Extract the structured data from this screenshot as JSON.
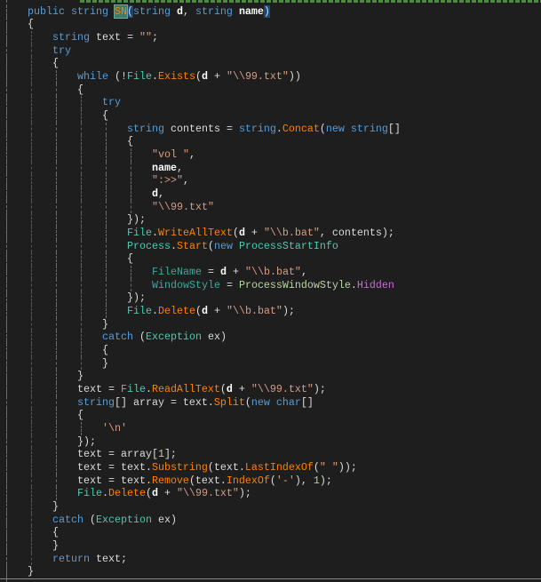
{
  "editor": {
    "guide_colors": [
      "#2f8f5f",
      "#2a5f95",
      "#c84444",
      "#8a3ab8",
      "#c84444",
      "#6a6a6a"
    ],
    "lines": [
      {
        "indent": 1,
        "tokens": [
          {
            "t": "public",
            "c": "kw"
          },
          {
            "t": " "
          },
          {
            "t": "string",
            "c": "kw"
          },
          {
            "t": " "
          },
          {
            "t": "SN",
            "c": "method",
            "hl": "ref"
          },
          {
            "t": "(",
            "c": "punct",
            "hl": "brace"
          },
          {
            "t": "string",
            "c": "kw"
          },
          {
            "t": " "
          },
          {
            "t": "d",
            "c": "param"
          },
          {
            "t": ", "
          },
          {
            "t": "string",
            "c": "kw"
          },
          {
            "t": " "
          },
          {
            "t": "name",
            "c": "param"
          },
          {
            "t": ")",
            "c": "punct",
            "hl": "brace"
          }
        ]
      },
      {
        "indent": 1,
        "tokens": [
          {
            "t": "{"
          }
        ]
      },
      {
        "indent": 2,
        "tokens": [
          {
            "t": "string",
            "c": "kw"
          },
          {
            "t": " text = "
          },
          {
            "t": "\"\"",
            "c": "str"
          },
          {
            "t": ";"
          }
        ]
      },
      {
        "indent": 2,
        "tokens": [
          {
            "t": "try",
            "c": "kw"
          }
        ]
      },
      {
        "indent": 2,
        "tokens": [
          {
            "t": "{"
          }
        ]
      },
      {
        "indent": 3,
        "tokens": [
          {
            "t": "while",
            "c": "kw"
          },
          {
            "t": " (!"
          },
          {
            "t": "File",
            "c": "type"
          },
          {
            "t": "."
          },
          {
            "t": "Exists",
            "c": "method"
          },
          {
            "t": "("
          },
          {
            "t": "d",
            "c": "param"
          },
          {
            "t": " + "
          },
          {
            "t": "\"\\\\99.txt\"",
            "c": "str"
          },
          {
            "t": "))"
          }
        ]
      },
      {
        "indent": 3,
        "tokens": [
          {
            "t": "{"
          }
        ]
      },
      {
        "indent": 4,
        "tokens": [
          {
            "t": "try",
            "c": "kw"
          }
        ]
      },
      {
        "indent": 4,
        "tokens": [
          {
            "t": "{"
          }
        ]
      },
      {
        "indent": 5,
        "tokens": [
          {
            "t": "string",
            "c": "kw"
          },
          {
            "t": " contents = "
          },
          {
            "t": "string",
            "c": "kw"
          },
          {
            "t": "."
          },
          {
            "t": "Concat",
            "c": "method"
          },
          {
            "t": "("
          },
          {
            "t": "new",
            "c": "kw"
          },
          {
            "t": " "
          },
          {
            "t": "string",
            "c": "kw"
          },
          {
            "t": "[]"
          }
        ]
      },
      {
        "indent": 5,
        "tokens": [
          {
            "t": "{"
          }
        ]
      },
      {
        "indent": 6,
        "init": true,
        "tokens": [
          {
            "t": "\"vol \"",
            "c": "str"
          },
          {
            "t": ","
          }
        ]
      },
      {
        "indent": 6,
        "init": true,
        "tokens": [
          {
            "t": "name",
            "c": "param"
          },
          {
            "t": ","
          }
        ]
      },
      {
        "indent": 6,
        "init": true,
        "tokens": [
          {
            "t": "\":>>\"",
            "c": "str"
          },
          {
            "t": ","
          }
        ]
      },
      {
        "indent": 6,
        "init": true,
        "tokens": [
          {
            "t": "d",
            "c": "param"
          },
          {
            "t": ","
          }
        ]
      },
      {
        "indent": 6,
        "init": true,
        "tokens": [
          {
            "t": "\"\\\\99.txt\"",
            "c": "str"
          }
        ]
      },
      {
        "indent": 5,
        "tokens": [
          {
            "t": "});"
          }
        ]
      },
      {
        "indent": 5,
        "tokens": [
          {
            "t": "File",
            "c": "type"
          },
          {
            "t": "."
          },
          {
            "t": "WriteAllText",
            "c": "method"
          },
          {
            "t": "("
          },
          {
            "t": "d",
            "c": "param"
          },
          {
            "t": " + "
          },
          {
            "t": "\"\\\\b.bat\"",
            "c": "str"
          },
          {
            "t": ", contents);"
          }
        ]
      },
      {
        "indent": 5,
        "tokens": [
          {
            "t": "Process",
            "c": "type"
          },
          {
            "t": "."
          },
          {
            "t": "Start",
            "c": "method"
          },
          {
            "t": "("
          },
          {
            "t": "new",
            "c": "kw"
          },
          {
            "t": " "
          },
          {
            "t": "ProcessStartInfo",
            "c": "type"
          }
        ]
      },
      {
        "indent": 5,
        "tokens": [
          {
            "t": "{"
          }
        ]
      },
      {
        "indent": 6,
        "init": true,
        "tokens": [
          {
            "t": "FileName",
            "c": "prop"
          },
          {
            "t": " = "
          },
          {
            "t": "d",
            "c": "param"
          },
          {
            "t": " + "
          },
          {
            "t": "\"\\\\b.bat\"",
            "c": "str"
          },
          {
            "t": ","
          }
        ]
      },
      {
        "indent": 6,
        "init": true,
        "tokens": [
          {
            "t": "WindowStyle",
            "c": "prop"
          },
          {
            "t": " = "
          },
          {
            "t": "ProcessWindowStyle",
            "c": "enumtype"
          },
          {
            "t": "."
          },
          {
            "t": "Hidden",
            "c": "enumfield"
          }
        ]
      },
      {
        "indent": 5,
        "tokens": [
          {
            "t": "});"
          }
        ]
      },
      {
        "indent": 5,
        "tokens": [
          {
            "t": "File",
            "c": "type"
          },
          {
            "t": "."
          },
          {
            "t": "Delete",
            "c": "method"
          },
          {
            "t": "("
          },
          {
            "t": "d",
            "c": "param"
          },
          {
            "t": " + "
          },
          {
            "t": "\"\\\\b.bat\"",
            "c": "str"
          },
          {
            "t": ");"
          }
        ]
      },
      {
        "indent": 4,
        "tokens": [
          {
            "t": "}"
          }
        ]
      },
      {
        "indent": 4,
        "tokens": [
          {
            "t": "catch",
            "c": "kw"
          },
          {
            "t": " ("
          },
          {
            "t": "Exception",
            "c": "type"
          },
          {
            "t": " ex)"
          }
        ]
      },
      {
        "indent": 4,
        "tokens": [
          {
            "t": "{"
          }
        ]
      },
      {
        "indent": 4,
        "tokens": [
          {
            "t": "}"
          }
        ]
      },
      {
        "indent": 3,
        "tokens": [
          {
            "t": "}"
          }
        ]
      },
      {
        "indent": 3,
        "tokens": [
          {
            "t": "text = "
          },
          {
            "t": "File",
            "c": "type"
          },
          {
            "t": "."
          },
          {
            "t": "ReadAllText",
            "c": "method"
          },
          {
            "t": "("
          },
          {
            "t": "d",
            "c": "param"
          },
          {
            "t": " + "
          },
          {
            "t": "\"\\\\99.txt\"",
            "c": "str"
          },
          {
            "t": ");"
          }
        ]
      },
      {
        "indent": 3,
        "tokens": [
          {
            "t": "string",
            "c": "kw"
          },
          {
            "t": "[] array = text."
          },
          {
            "t": "Split",
            "c": "method"
          },
          {
            "t": "("
          },
          {
            "t": "new",
            "c": "kw"
          },
          {
            "t": " "
          },
          {
            "t": "char",
            "c": "kw"
          },
          {
            "t": "[]"
          }
        ]
      },
      {
        "indent": 3,
        "tokens": [
          {
            "t": "{"
          }
        ]
      },
      {
        "indent": 4,
        "init": true,
        "tokens": [
          {
            "t": "'\\n'",
            "c": "str"
          }
        ]
      },
      {
        "indent": 3,
        "tokens": [
          {
            "t": "});"
          }
        ]
      },
      {
        "indent": 3,
        "tokens": [
          {
            "t": "text = array["
          },
          {
            "t": "1",
            "c": "num"
          },
          {
            "t": "];"
          }
        ]
      },
      {
        "indent": 3,
        "tokens": [
          {
            "t": "text = text."
          },
          {
            "t": "Substring",
            "c": "method"
          },
          {
            "t": "(text."
          },
          {
            "t": "LastIndexOf",
            "c": "method"
          },
          {
            "t": "("
          },
          {
            "t": "\" \"",
            "c": "str"
          },
          {
            "t": "));"
          }
        ]
      },
      {
        "indent": 3,
        "tokens": [
          {
            "t": "text = text."
          },
          {
            "t": "Remove",
            "c": "method"
          },
          {
            "t": "(text."
          },
          {
            "t": "IndexOf",
            "c": "method"
          },
          {
            "t": "("
          },
          {
            "t": "'-'",
            "c": "str"
          },
          {
            "t": "), "
          },
          {
            "t": "1",
            "c": "num"
          },
          {
            "t": ");"
          }
        ]
      },
      {
        "indent": 3,
        "tokens": [
          {
            "t": "File",
            "c": "type"
          },
          {
            "t": "."
          },
          {
            "t": "Delete",
            "c": "method"
          },
          {
            "t": "("
          },
          {
            "t": "d",
            "c": "param"
          },
          {
            "t": " + "
          },
          {
            "t": "\"\\\\99.txt\"",
            "c": "str"
          },
          {
            "t": ");"
          }
        ]
      },
      {
        "indent": 2,
        "tokens": [
          {
            "t": "}"
          }
        ]
      },
      {
        "indent": 2,
        "tokens": [
          {
            "t": "catch",
            "c": "kw"
          },
          {
            "t": " ("
          },
          {
            "t": "Exception",
            "c": "type"
          },
          {
            "t": " ex)"
          }
        ]
      },
      {
        "indent": 2,
        "tokens": [
          {
            "t": "{"
          }
        ]
      },
      {
        "indent": 2,
        "tokens": [
          {
            "t": "}"
          }
        ]
      },
      {
        "indent": 2,
        "tokens": [
          {
            "t": "return",
            "c": "kw"
          },
          {
            "t": " text;"
          }
        ]
      },
      {
        "indent": 1,
        "tokens": [
          {
            "t": "}"
          }
        ]
      }
    ]
  }
}
